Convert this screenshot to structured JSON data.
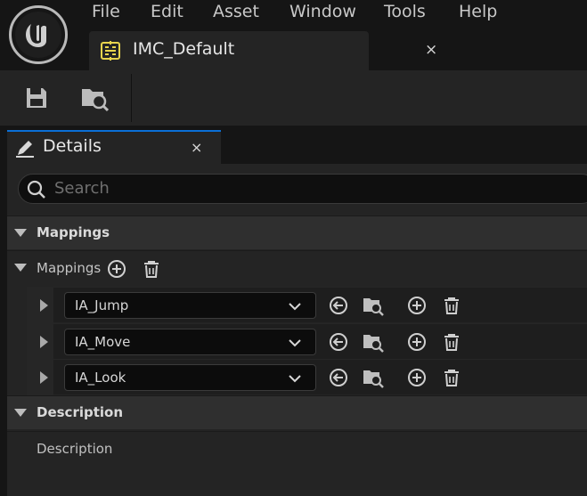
{
  "menu": {
    "items": [
      "File",
      "Edit",
      "Asset",
      "Window",
      "Tools",
      "Help"
    ]
  },
  "asset_tab": {
    "label": "IMC_Default",
    "close": "×",
    "icon": "input-mapping-icon"
  },
  "toolbar": {
    "buttons": [
      "save-icon",
      "browse-icon"
    ]
  },
  "details_tab": {
    "label": "Details",
    "close": "×",
    "icon": "pencil-icon"
  },
  "search": {
    "placeholder": "Search"
  },
  "categories": {
    "mappings": "Mappings",
    "description": "Description"
  },
  "mappings_array": {
    "label": "Mappings"
  },
  "mappings": [
    {
      "action": "IA_Jump"
    },
    {
      "action": "IA_Move"
    },
    {
      "action": "IA_Look"
    }
  ],
  "description_field": {
    "label": "Description"
  },
  "colors": {
    "accent": "#0a6fd6",
    "asset_icon": "#e8d44d"
  }
}
